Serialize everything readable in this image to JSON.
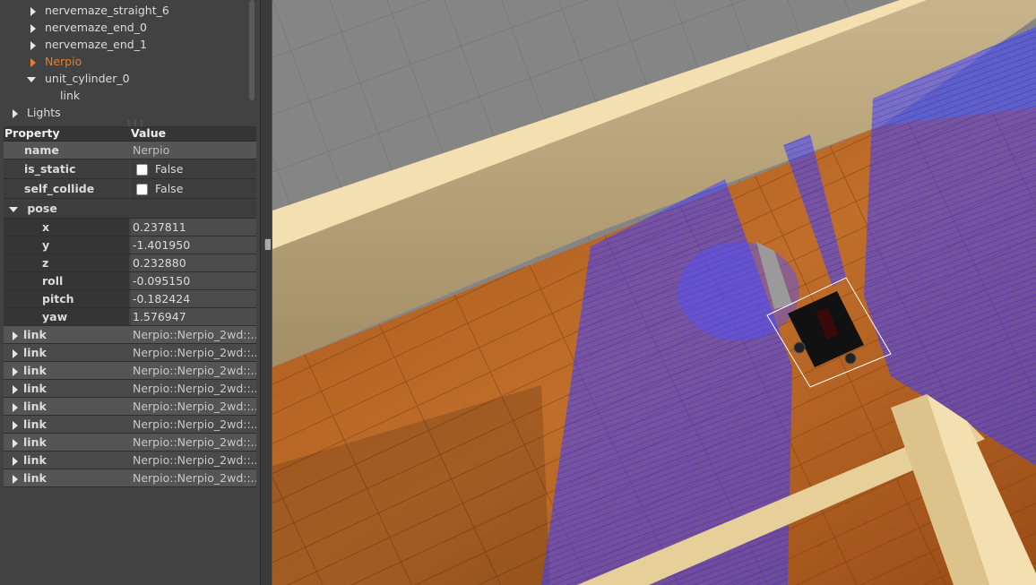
{
  "tree": {
    "items": [
      {
        "label": "nervemaze_straight_6",
        "expanded": false,
        "highlight": false
      },
      {
        "label": "nervemaze_end_0",
        "expanded": false,
        "highlight": false
      },
      {
        "label": "nervemaze_end_1",
        "expanded": false,
        "highlight": false
      },
      {
        "label": "Nerpio",
        "expanded": false,
        "highlight": true
      },
      {
        "label": "unit_cylinder_0",
        "expanded": true,
        "highlight": false
      },
      {
        "label": "link",
        "expanded": null,
        "highlight": false
      },
      {
        "label": "Lights",
        "expanded": false,
        "highlight": false
      }
    ]
  },
  "props": {
    "header_property": "Property",
    "header_value": "Value",
    "name_key": "name",
    "name_val": "Nerpio",
    "is_static_key": "is_static",
    "is_static_val": "False",
    "self_collide_key": "self_collide",
    "self_collide_val": "False",
    "pose_key": "pose",
    "pose": [
      {
        "key": "x",
        "val": "0.237811"
      },
      {
        "key": "y",
        "val": "-1.401950"
      },
      {
        "key": "z",
        "val": "0.232880"
      },
      {
        "key": "roll",
        "val": "-0.095150"
      },
      {
        "key": "pitch",
        "val": "-0.182424"
      },
      {
        "key": "yaw",
        "val": "1.576947"
      }
    ],
    "links": [
      {
        "key": "link",
        "val": "Nerpio::Nerpio_2wd::..."
      },
      {
        "key": "link",
        "val": "Nerpio::Nerpio_2wd::..."
      },
      {
        "key": "link",
        "val": "Nerpio::Nerpio_2wd::..."
      },
      {
        "key": "link",
        "val": "Nerpio::Nerpio_2wd::..."
      },
      {
        "key": "link",
        "val": "Nerpio::Nerpio_2wd::..."
      },
      {
        "key": "link",
        "val": "Nerpio::Nerpio_2wd::..."
      },
      {
        "key": "link",
        "val": "Nerpio::Nerpio_2wd::..."
      },
      {
        "key": "link",
        "val": "Nerpio::Nerpio_2wd::..."
      },
      {
        "key": "link",
        "val": "Nerpio::Nerpio_2wd::..."
      }
    ]
  },
  "colors": {
    "highlight": "#e87d2a",
    "panel": "#424242",
    "laser": "#3b3bff",
    "wall": "#f3dfb0",
    "floor": "#b8631e"
  }
}
